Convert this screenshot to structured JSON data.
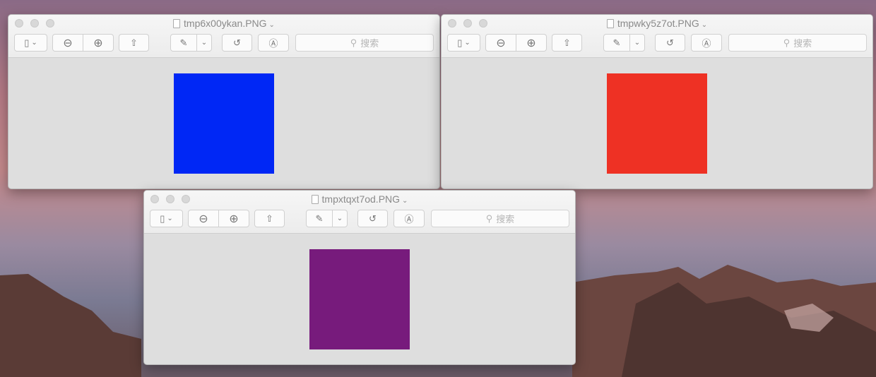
{
  "windows": [
    {
      "title": "tmp6x00ykan.PNG",
      "image_color": "#0027f5",
      "search_placeholder": "搜索"
    },
    {
      "title": "tmpwky5z7ot.PNG",
      "image_color": "#ee3124",
      "search_placeholder": "搜索"
    },
    {
      "title": "tmpxtqxt7od.PNG",
      "image_color": "#771b7c",
      "search_placeholder": "搜索"
    }
  ],
  "icons": {
    "sidebar": "▯",
    "chevron": "⌄",
    "zoom_out": "⊖",
    "zoom_in": "⊕",
    "share": "⇧",
    "markup": "✎",
    "rotate": "↺",
    "annotate": "Ⓐ",
    "search": "⚲"
  }
}
